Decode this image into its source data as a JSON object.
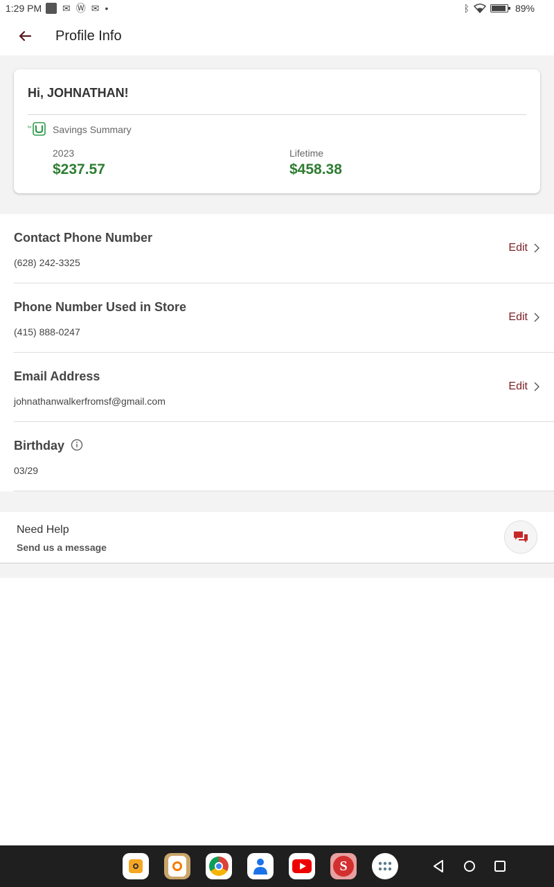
{
  "status_bar": {
    "time": "1:29 PM",
    "battery_pct": "89%",
    "icons_left": [
      "gallery-icon",
      "gmail-icon",
      "wordpress-icon",
      "gmail-icon",
      "dot-icon"
    ],
    "icons_right": [
      "bluetooth-icon",
      "wifi-icon",
      "battery-icon"
    ]
  },
  "header": {
    "title": "Profile Info",
    "back_icon": "arrow-left-icon"
  },
  "summary": {
    "greeting": "Hi, JOHNATHAN!",
    "label": "Savings Summary",
    "logo": "for-u-logo",
    "year_label": "2023",
    "year_value": "$237.57",
    "lifetime_label": "Lifetime",
    "lifetime_value": "$458.38"
  },
  "rows": [
    {
      "title": "Contact Phone Number",
      "value": "(628) 242-3325",
      "edit": "Edit"
    },
    {
      "title": "Phone Number Used in Store",
      "value": "(415) 888-0247",
      "edit": "Edit"
    },
    {
      "title": "Email Address",
      "value": "johnathanwalkerfromsf@gmail.com",
      "edit": "Edit"
    },
    {
      "title": "Birthday",
      "value": "03/29"
    }
  ],
  "help": {
    "title": "Need Help",
    "subtitle": "Send us a message"
  },
  "dock": {
    "apps": [
      "camera-app-icon",
      "orange-app-icon",
      "chrome-icon",
      "contacts-icon",
      "youtube-icon",
      "safeway-icon",
      "app-drawer-icon"
    ],
    "nav": [
      "back-nav-icon",
      "home-nav-icon",
      "recents-nav-icon"
    ]
  },
  "colors": {
    "accent": "#7b1f24",
    "savings_green": "#2e7d32",
    "chat_red": "#c62828",
    "band_gray": "#f3f3f3"
  }
}
